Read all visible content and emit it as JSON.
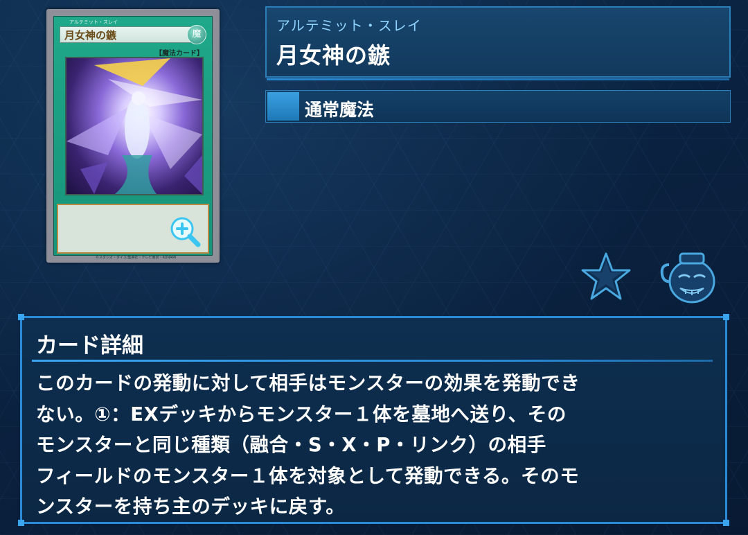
{
  "card": {
    "name": "月女神の鏃",
    "ruby": "アルテミット・スレイ",
    "attribute": "魔",
    "type_line": "【魔法カード】",
    "copyright": "©スタジオ・ダイス/集英社・テレビ東京・KONAMI",
    "zoom_icon": "zoom-in-icon"
  },
  "header": {
    "ruby": "アルテミット・スレイ",
    "title": "月女神の鏃"
  },
  "card_type": {
    "label": "通常魔法"
  },
  "actions": {
    "favorite_icon": "star-icon",
    "pot_icon": "pot-of-greed-icon"
  },
  "details": {
    "heading": "カード詳細",
    "lines": [
      "このカードの発動に対して相手はモンスターの効果を発動でき",
      "ない。①：EXデッキからモンスター１体を墓地へ送り、その",
      "モンスターと同じ種類（融合・S・X・P・リンク）の相手",
      "フィールドのモンスター１体を対象として発動できる。そのモ",
      "ンスターを持ち主のデッキに戻す。"
    ]
  },
  "colors": {
    "accent": "#2a8ad6",
    "background": "#0a2240",
    "ruby_text": "#8fd4ff",
    "card_green": "#1fa88a"
  }
}
